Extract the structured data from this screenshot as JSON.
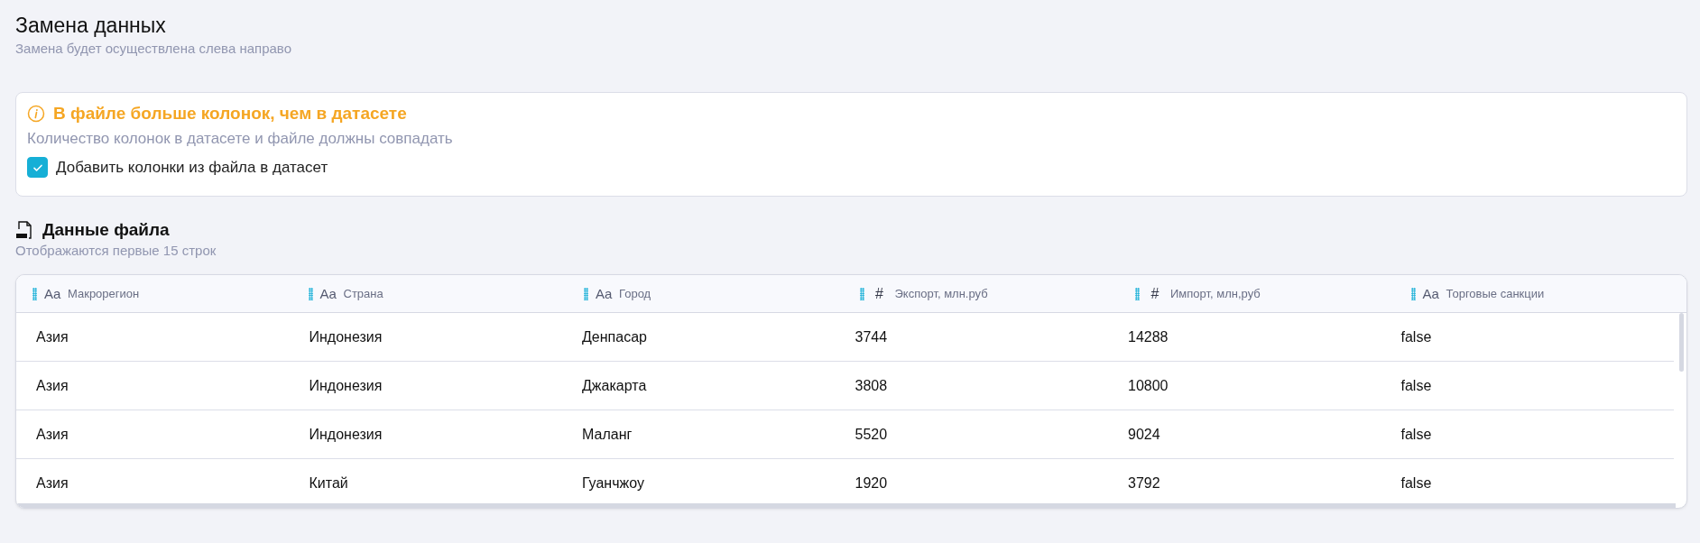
{
  "page": {
    "title": "Замена данных",
    "subtitle": "Замена будет осуществлена слева направо"
  },
  "alert": {
    "title": "В файле больше колонок, чем в датасете",
    "message": "Количество колонок в датасете и файле должны совпадать",
    "checkbox": {
      "label": "Добавить колонки из файла в датасет",
      "checked": true
    }
  },
  "file_section": {
    "title": "Данные файла",
    "subtitle": "Отображаются первые 15 строк"
  },
  "table": {
    "columns": [
      {
        "label": "Макрорегион",
        "type_label": "Aa",
        "kind": "text"
      },
      {
        "label": "Страна",
        "type_label": "Aa",
        "kind": "text"
      },
      {
        "label": "Город",
        "type_label": "Aa",
        "kind": "text"
      },
      {
        "label": "Экспорт, млн.руб",
        "type_label": "#",
        "kind": "number"
      },
      {
        "label": "Импорт, млн,руб",
        "type_label": "#",
        "kind": "number"
      },
      {
        "label": "Торговые санкции",
        "type_label": "Aa",
        "kind": "text"
      }
    ],
    "rows": [
      [
        "Азия",
        "Индонезия",
        "Денпасар",
        "3744",
        "14288",
        "false"
      ],
      [
        "Азия",
        "Индонезия",
        "Джакарта",
        "3808",
        "10800",
        "false"
      ],
      [
        "Азия",
        "Индонезия",
        "Маланг",
        "5520",
        "9024",
        "false"
      ],
      [
        "Азия",
        "Китай",
        "Гуанчжоу",
        "1920",
        "3792",
        "false"
      ]
    ]
  }
}
